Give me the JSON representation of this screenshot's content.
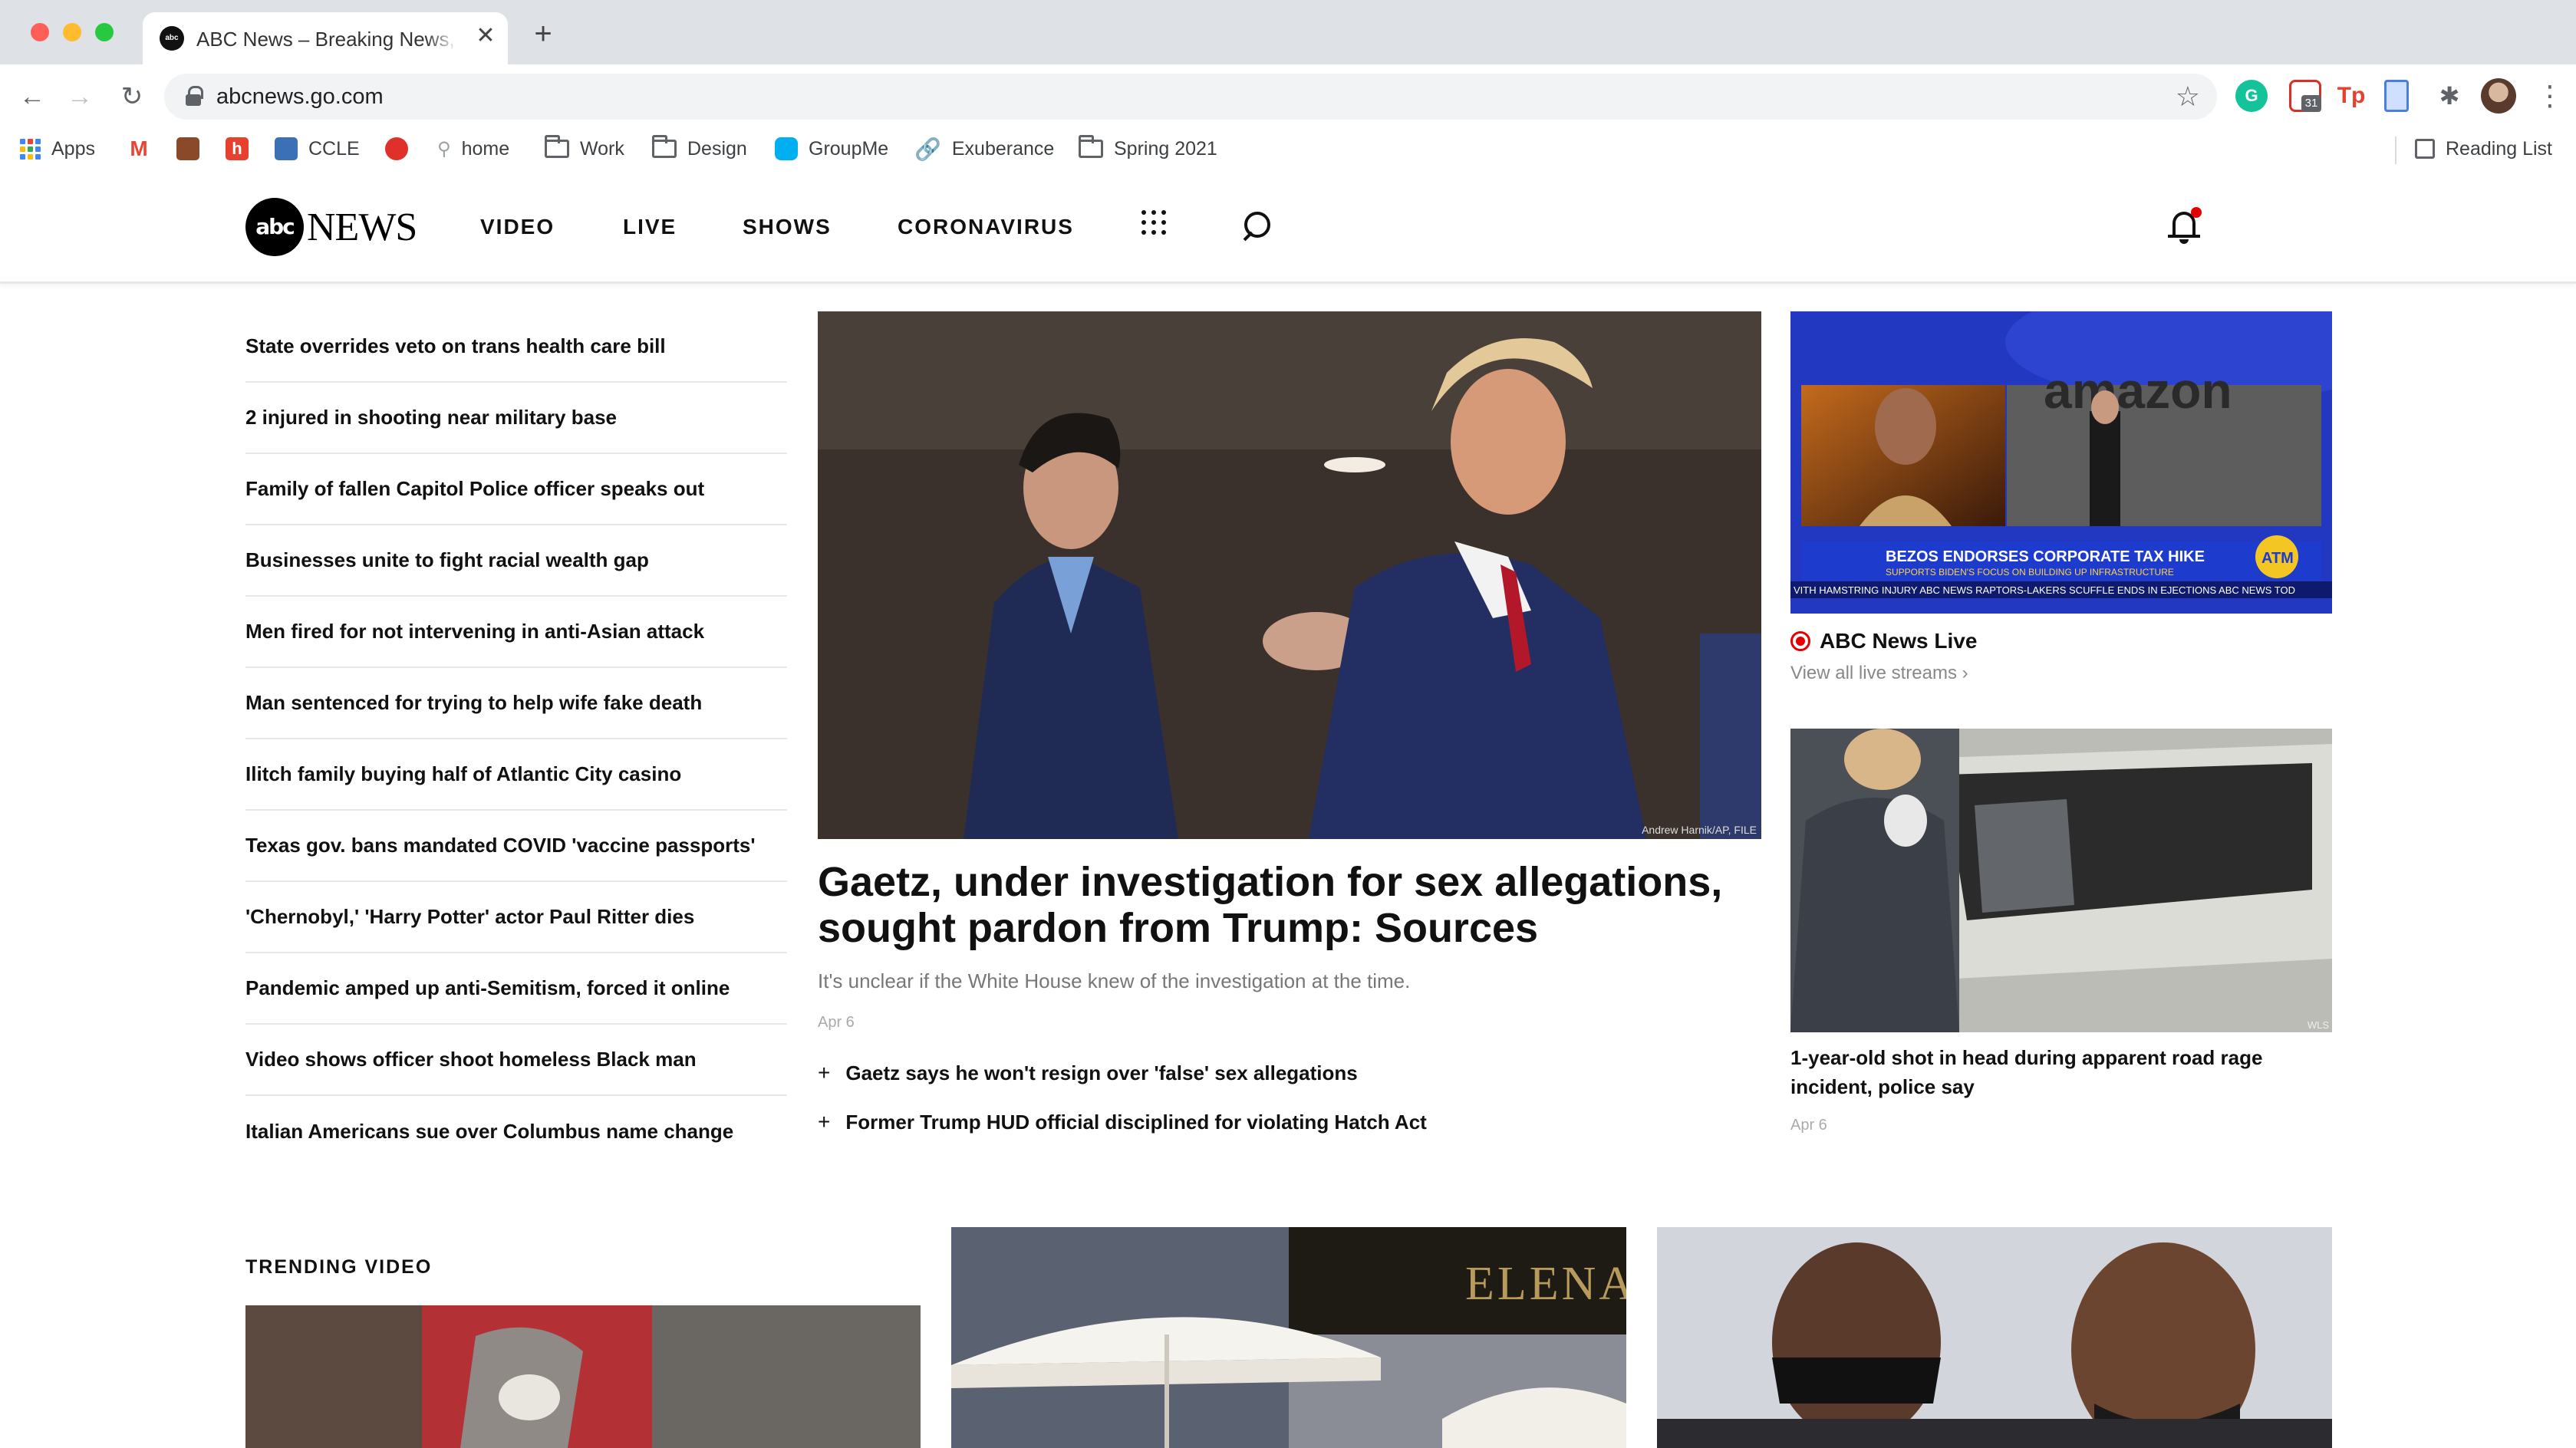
{
  "browser": {
    "tab_title": "ABC News – Breaking News, Latest News and Videos",
    "tab_favicon": "abc",
    "close_glyph": "✕",
    "new_tab_glyph": "+",
    "url": "abcnews.go.com",
    "extension_badge": "31",
    "extension_tp": "Tp",
    "bookmarks": [
      {
        "label": "Apps",
        "icon": "apps-grid-icon"
      },
      {
        "label": "",
        "icon": "gmail-icon"
      },
      {
        "label": "",
        "icon": "book-icon"
      },
      {
        "label": "",
        "icon": "h-icon"
      },
      {
        "label": "CCLE",
        "icon": "ccle-icon"
      },
      {
        "label": "",
        "icon": "tomato-icon"
      },
      {
        "label": "home",
        "icon": "pin-icon"
      },
      {
        "label": "Work",
        "icon": "folder-icon"
      },
      {
        "label": "Design",
        "icon": "folder-icon"
      },
      {
        "label": "GroupMe",
        "icon": "groupme-icon"
      },
      {
        "label": "Exuberance",
        "icon": "link-icon"
      },
      {
        "label": "Spring 2021",
        "icon": "folder-icon"
      }
    ],
    "reading_list": "Reading List"
  },
  "site": {
    "logo_disc": "abc",
    "logo_word": "NEWS",
    "nav": [
      "VIDEO",
      "LIVE",
      "SHOWS",
      "CORONAVIRUS"
    ]
  },
  "headlines": [
    "State overrides veto on trans health care bill",
    "2 injured in shooting near military base",
    "Family of fallen Capitol Police officer speaks out",
    "Businesses unite to fight racial wealth gap",
    "Men fired for not intervening in anti-Asian attack",
    "Man sentenced for trying to help wife fake death",
    "Ilitch family buying half of Atlantic City casino",
    "Texas gov. bans mandated COVID 'vaccine passports'",
    "'Chernobyl,' 'Harry Potter' actor Paul Ritter dies",
    "Pandemic amped up anti-Semitism, forced it online",
    "Video shows officer shoot homeless Black man",
    "Italian Americans sue over Columbus name change"
  ],
  "lead": {
    "photo_credit": "Andrew Harnik/AP, FILE",
    "title": "Gaetz, under investigation for sex allegations, sought pardon from Trump: Sources",
    "subtitle": "It's unclear if the White House knew of the investigation at the time.",
    "date": "Apr 6",
    "related": [
      "Gaetz says he won't resign over 'false' sex allegations",
      "Former Trump HUD official disciplined for violating Hatch Act"
    ]
  },
  "live": {
    "thumb_brand": "amazon",
    "lower_third": "BEZOS ENDORSES CORPORATE TAX HIKE",
    "lower_third_sub": "SUPPORTS BIDEN'S FOCUS ON BUILDING UP INFRASTRUCTURE",
    "ticker": "VITH HAMSTRING INJURY   ABC NEWS   RAPTORS-LAKERS SCUFFLE ENDS IN EJECTIONS   ABC NEWS   TOD",
    "badge": "ATM",
    "label": "ABC News Live",
    "link": "View all live streams ›"
  },
  "story2": {
    "photo_credit": "WLS",
    "title": "1-year-old shot in head during apparent road rage incident, police say",
    "date": "Apr 6"
  },
  "trending": {
    "label": "TRENDING VIDEO",
    "sign_text": "ELENA"
  }
}
